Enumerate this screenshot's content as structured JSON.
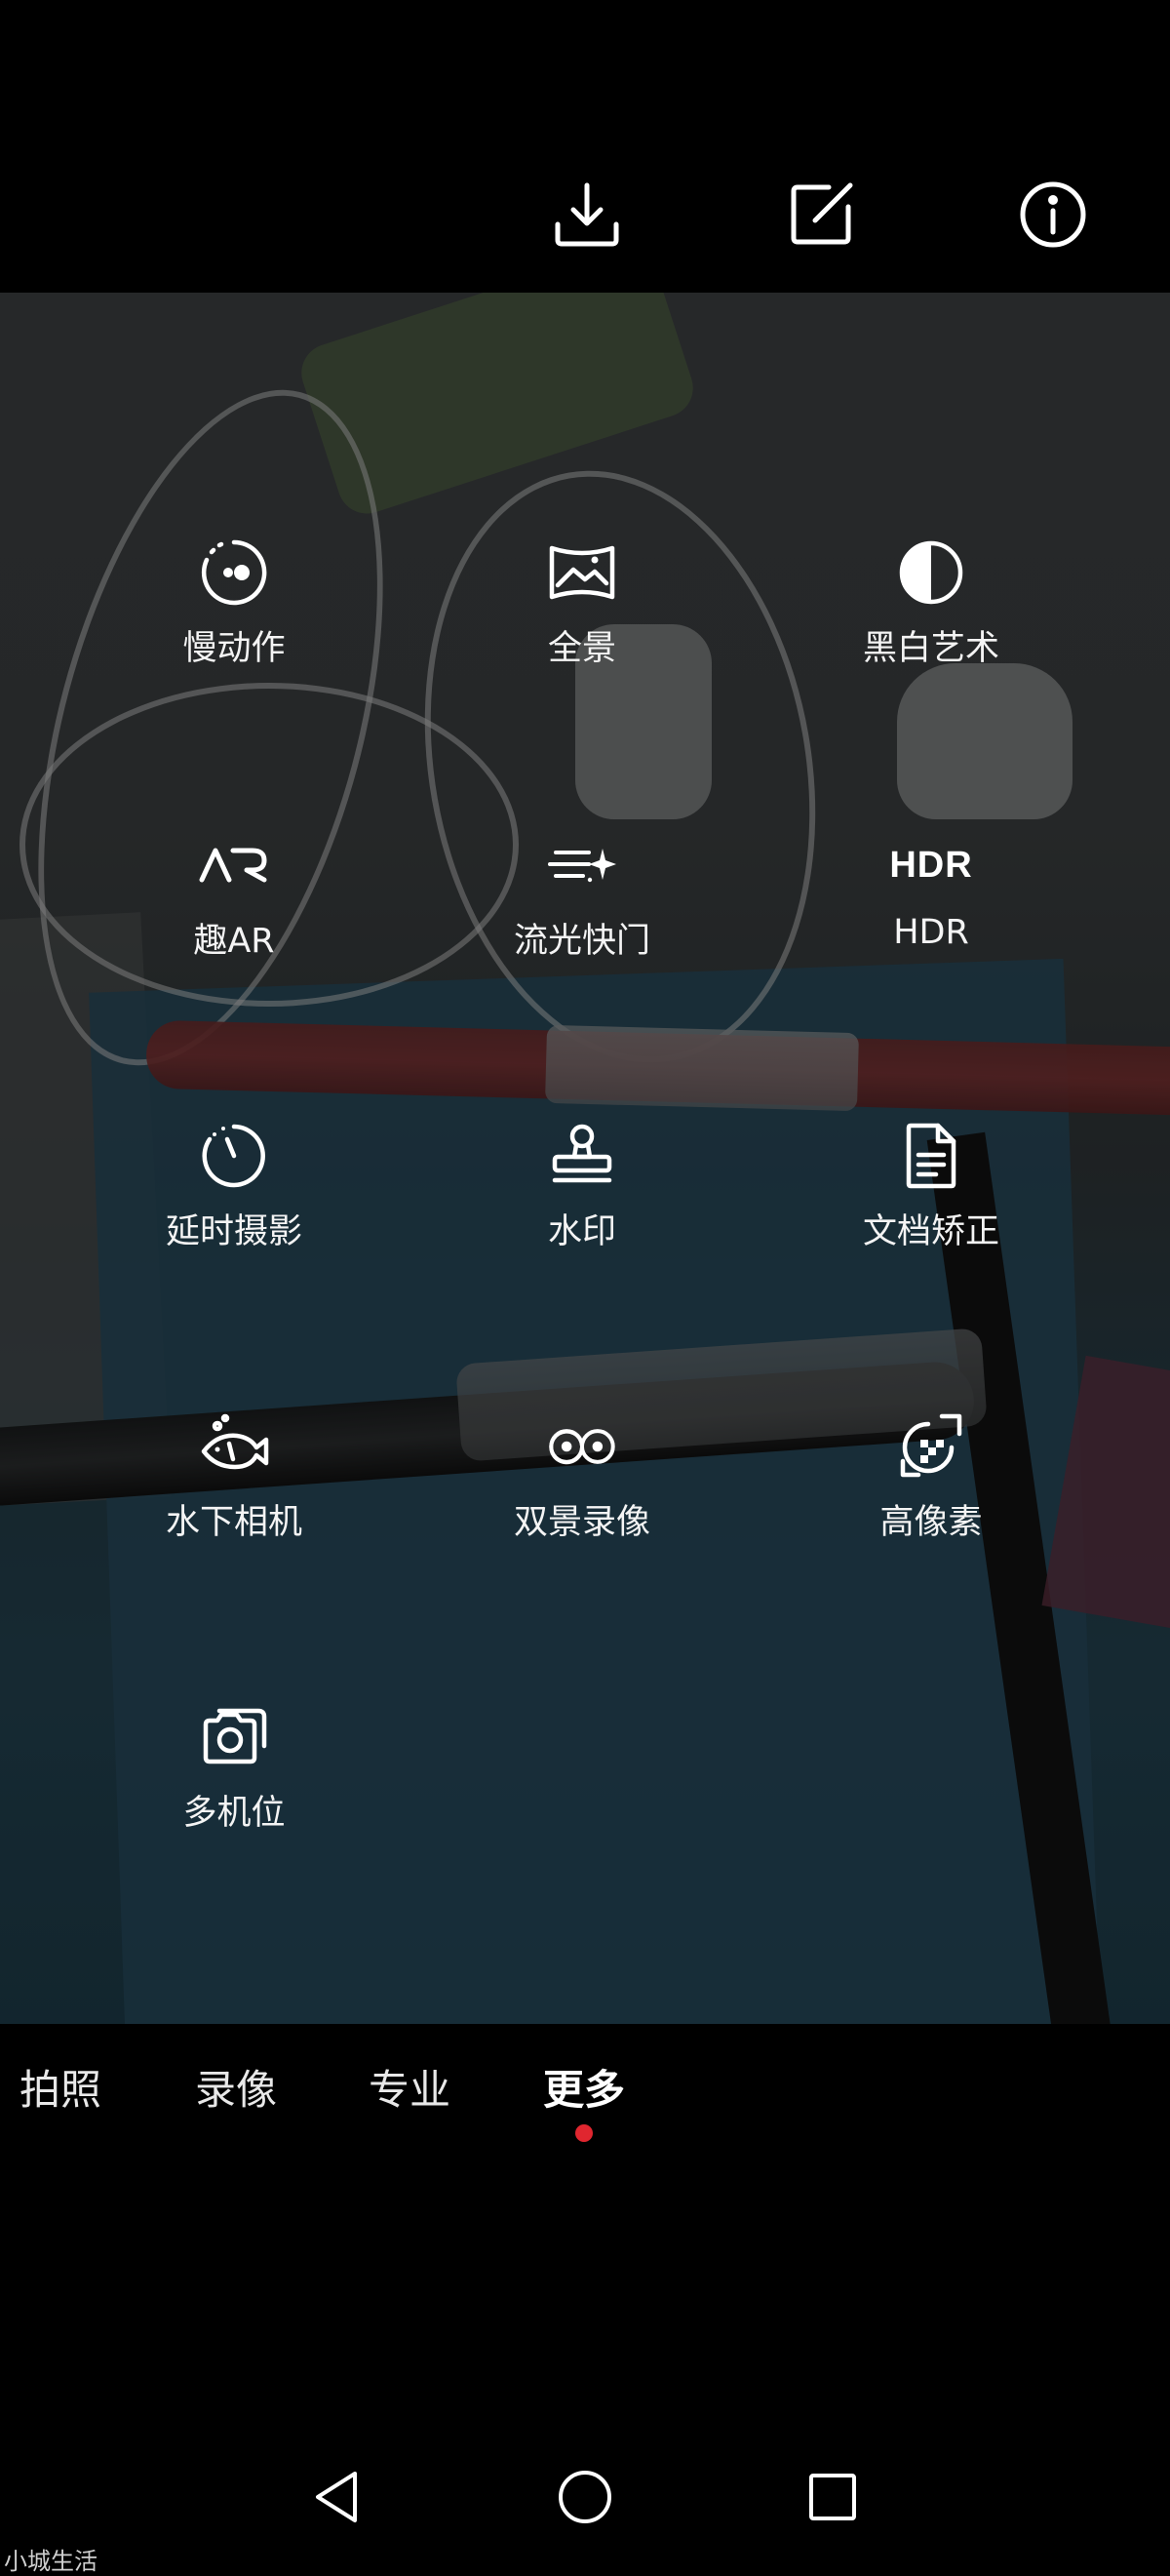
{
  "top_bar": {
    "icons": [
      "download-icon",
      "edit-icon",
      "info-icon"
    ]
  },
  "modes": [
    {
      "label": "慢动作",
      "icon": "slow-motion-icon"
    },
    {
      "label": "全景",
      "icon": "panorama-icon"
    },
    {
      "label": "黑白艺术",
      "icon": "monochrome-icon"
    },
    {
      "label": "趣AR",
      "icon": "ar-icon"
    },
    {
      "label": "流光快门",
      "icon": "light-painting-icon"
    },
    {
      "label": "HDR",
      "icon": "hdr-icon",
      "icon_text": "HDR"
    },
    {
      "label": "延时摄影",
      "icon": "timelapse-icon"
    },
    {
      "label": "水印",
      "icon": "watermark-stamp-icon"
    },
    {
      "label": "文档矫正",
      "icon": "document-icon"
    },
    {
      "label": "水下相机",
      "icon": "underwater-fish-icon"
    },
    {
      "label": "双景录像",
      "icon": "dual-view-icon"
    },
    {
      "label": "高像素",
      "icon": "high-resolution-icon"
    },
    {
      "label": "多机位",
      "icon": "multi-camera-icon"
    }
  ],
  "tabs": [
    {
      "label": "拍照"
    },
    {
      "label": "录像"
    },
    {
      "label": "专业"
    },
    {
      "label": "更多",
      "active": true
    }
  ],
  "active_indicator_color": "#e0262f",
  "nav": {
    "icons": [
      "back-icon",
      "home-icon",
      "recents-icon"
    ]
  },
  "watermark": "小城生活"
}
